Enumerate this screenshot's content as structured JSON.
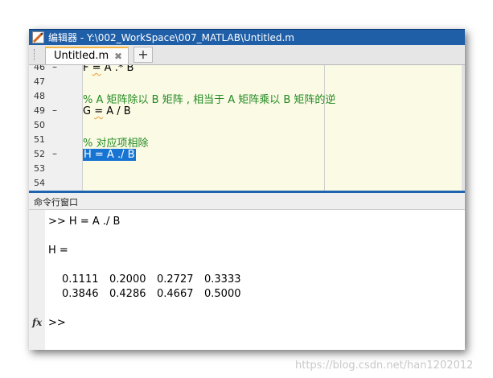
{
  "window": {
    "title": "编辑器 - Y:\\002_WorkSpace\\007_MATLAB\\Untitled.m"
  },
  "tabs": {
    "active_label": "Untitled.m",
    "close_glyph": "✖",
    "add_glyph": "+"
  },
  "editor": {
    "lines": [
      {
        "num": "46",
        "dash": "–",
        "code_pre": "F ",
        "code_eq": "=",
        "code_post": " A .* B",
        "type": "code"
      },
      {
        "num": "47",
        "dash": "",
        "code": "",
        "type": "blank"
      },
      {
        "num": "48",
        "dash": "",
        "code": "% A 矩阵除以 B 矩阵 , 相当于 A 矩阵乘以 B 矩阵的逆",
        "type": "comment"
      },
      {
        "num": "49",
        "dash": "–",
        "code_pre": "G ",
        "code_eq": "=",
        "code_post": " A / B",
        "type": "code"
      },
      {
        "num": "50",
        "dash": "",
        "code": "",
        "type": "blank"
      },
      {
        "num": "51",
        "dash": "",
        "code": "% 对应项相除",
        "type": "comment"
      },
      {
        "num": "52",
        "dash": "–",
        "code": "H = A ./ B",
        "type": "selected"
      },
      {
        "num": "53",
        "dash": "",
        "code": "",
        "type": "blank"
      },
      {
        "num": "54",
        "dash": "",
        "code": "",
        "type": "blank"
      }
    ]
  },
  "command_window": {
    "title": "命令行窗口",
    "input_line": ">> H = A ./ B",
    "result_name": "H =",
    "matrix": [
      [
        "0.1111",
        "0.2000",
        "0.2727",
        "0.3333"
      ],
      [
        "0.3846",
        "0.4286",
        "0.4667",
        "0.5000"
      ]
    ],
    "prompt": ">>",
    "fx_icon": "fx"
  },
  "watermark": "https://blog.csdn.net/han1202012",
  "colors": {
    "titlebar": "#1f5fa8",
    "editor_bg": "#fbfae5",
    "comment": "#228b22",
    "selection": "#1874d2",
    "tab_accent": "#f5b642"
  }
}
